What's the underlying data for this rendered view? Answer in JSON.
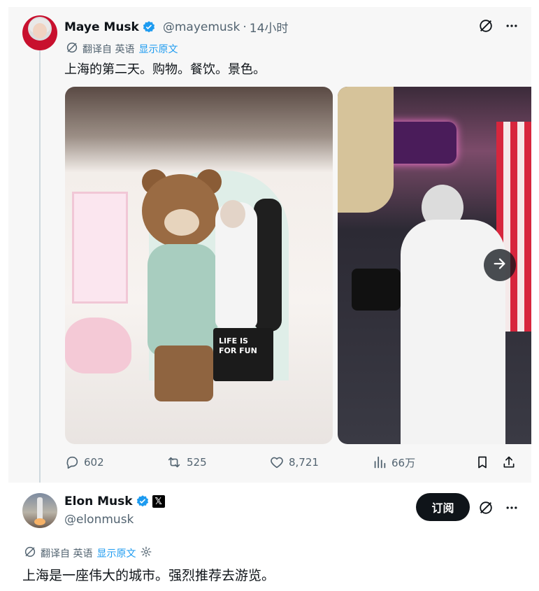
{
  "parent_tweet": {
    "author": {
      "display_name": "Maye Musk",
      "handle": "@mayemusk",
      "separator": "·",
      "time_ago": "14小时",
      "verified": true
    },
    "translation": {
      "translated_from": "翻译自 英语",
      "show_original": "显示原文"
    },
    "text": "上海的第二天。购物。餐饮。景色。",
    "media": {
      "photo1_bag_text": "LIFE IS FOR FUN",
      "next_icon": "arrow-right-icon"
    },
    "stats": {
      "replies": "602",
      "reposts": "525",
      "likes": "8,721",
      "views": "66万"
    }
  },
  "main_tweet": {
    "author": {
      "display_name": "Elon Musk",
      "handle": "@elonmusk",
      "verified": true,
      "affiliate_badge": "𝕏"
    },
    "subscribe_label": "订阅",
    "translation": {
      "translated_from": "翻译自 英语",
      "show_original": "显示原文"
    },
    "text": "上海是一座伟大的城市。强烈推荐去游览。"
  },
  "colors": {
    "verified_blue": "#1d9bf0",
    "secondary_text": "#536471",
    "link": "#1d9bf0",
    "primary_text": "#0f1419"
  }
}
